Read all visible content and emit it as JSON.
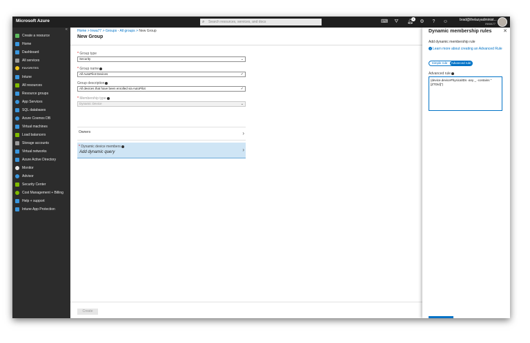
{
  "topbar": {
    "brand": "Microsoft Azure",
    "search_placeholder": "Search resources, services, and docs",
    "notification_count": "1",
    "user_email": "brad@thelazyadminist...",
    "user_tenant": "INWA77"
  },
  "sidebar": {
    "items": [
      {
        "label": "Create a resource",
        "icon": "plus-icon",
        "color": "#5cb85c"
      },
      {
        "label": "Home",
        "icon": "home-icon",
        "color": "#3a96dd"
      },
      {
        "label": "Dashboard",
        "icon": "dashboard-icon",
        "color": "#3a96dd"
      },
      {
        "label": "All services",
        "icon": "list-icon",
        "color": "#9a9a9a"
      },
      {
        "label": "FAVORITES",
        "icon": "star-icon",
        "color": "#f0c419"
      },
      {
        "label": "Intune",
        "icon": "intune-icon",
        "color": "#3a96dd"
      },
      {
        "label": "All resources",
        "icon": "grid-icon",
        "color": "#7fba00"
      },
      {
        "label": "Resource groups",
        "icon": "cube-icon",
        "color": "#3a96dd"
      },
      {
        "label": "App Services",
        "icon": "globe-icon",
        "color": "#3a96dd"
      },
      {
        "label": "SQL databases",
        "icon": "database-icon",
        "color": "#3a96dd"
      },
      {
        "label": "Azure Cosmos DB",
        "icon": "planet-icon",
        "color": "#3a96dd"
      },
      {
        "label": "Virtual machines",
        "icon": "monitor-icon",
        "color": "#3a96dd"
      },
      {
        "label": "Load balancers",
        "icon": "diamond-icon",
        "color": "#7fba00"
      },
      {
        "label": "Storage accounts",
        "icon": "storage-icon",
        "color": "#9a9a9a"
      },
      {
        "label": "Virtual networks",
        "icon": "network-icon",
        "color": "#3a96dd"
      },
      {
        "label": "Azure Active Directory",
        "icon": "pyramid-icon",
        "color": "#3a96dd"
      },
      {
        "label": "Monitor",
        "icon": "gauge-icon",
        "color": "#e8e8e8"
      },
      {
        "label": "Advisor",
        "icon": "cloud-icon",
        "color": "#3a96dd"
      },
      {
        "label": "Security Center",
        "icon": "shield-icon",
        "color": "#7fba00"
      },
      {
        "label": "Cost Management + Billing",
        "icon": "coin-icon",
        "color": "#7fba00"
      },
      {
        "label": "Help + support",
        "icon": "person-icon",
        "color": "#3a96dd"
      },
      {
        "label": "Intune App Protection",
        "icon": "app-protection-icon",
        "color": "#3a96dd"
      }
    ]
  },
  "main": {
    "breadcrumb": [
      "Home",
      "Inwa77",
      "Groups - All groups",
      "New Group"
    ],
    "title": "New Group",
    "group_type_label": "Group type",
    "group_type_value": "Security",
    "group_name_label": "Group name",
    "group_name_value": "All AutoPilot Devices",
    "group_desc_label": "Group description",
    "group_desc_value": "All devices that have been enrolled via AutoPilot",
    "membership_type_label": "Membership type",
    "membership_type_value": "Dynamic Device",
    "owners_label": "Owners",
    "dynamic_label": "Dynamic device members",
    "dynamic_query": "Add dynamic query",
    "create_label": "Create"
  },
  "panel": {
    "title": "Dynamic membership rules",
    "subtitle": "Add dynamic membership rule",
    "learn_link": "Learn more about creating an Advanced Rule",
    "simple_rule": "Simple rule",
    "advanced_rule": "Advanced rule",
    "advanced_label": "Advanced rule",
    "rule_text": "(device.devicePhysicalIDs -any _ -contains \"[ZTDId]\")"
  }
}
